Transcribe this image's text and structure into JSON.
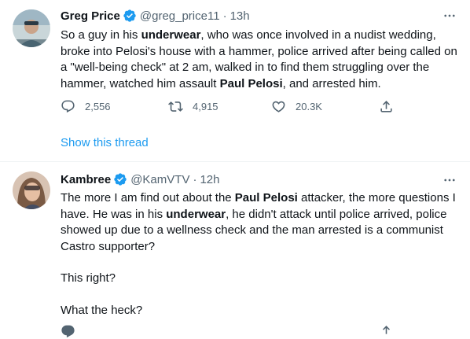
{
  "tweets": [
    {
      "name": "Greg Price",
      "handle": "@greg_price11",
      "dot": "·",
      "time": "13h",
      "paragraphs": [
        [
          "So a guy in his ",
          "underwear",
          ", who was once involved in a nudist wedding, broke into Pelosi's house with a hammer, police arrived after being called on a \"well-being check\" at 2 am, walked in to find them struggling over the hammer, watched him assault ",
          "Paul Pelosi",
          ", and arrested him."
        ]
      ],
      "replies": "2,556",
      "retweets": "4,915",
      "likes": "20.3K",
      "show_thread": "Show this thread"
    },
    {
      "name": "Kambree",
      "handle": "@KamVTV",
      "dot": "·",
      "time": "12h",
      "paragraphs": [
        [
          "The more I am find out about the ",
          "Paul Pelosi",
          " attacker, the more questions I have.  He was in his ",
          "underwear",
          ", he didn't attack until police arrived, police showed up due to a wellness check and the man arrested is a communist Castro supporter?"
        ],
        [
          "This right?"
        ],
        [
          "What the heck?"
        ]
      ]
    }
  ],
  "colors": {
    "verified": "#1d9bf0",
    "link": "#1d9bf0",
    "secondary": "#536471",
    "text": "#0f1419"
  },
  "icons": [
    "verified-badge-icon",
    "more-options-icon",
    "reply-icon",
    "retweet-icon",
    "like-icon",
    "share-icon"
  ]
}
